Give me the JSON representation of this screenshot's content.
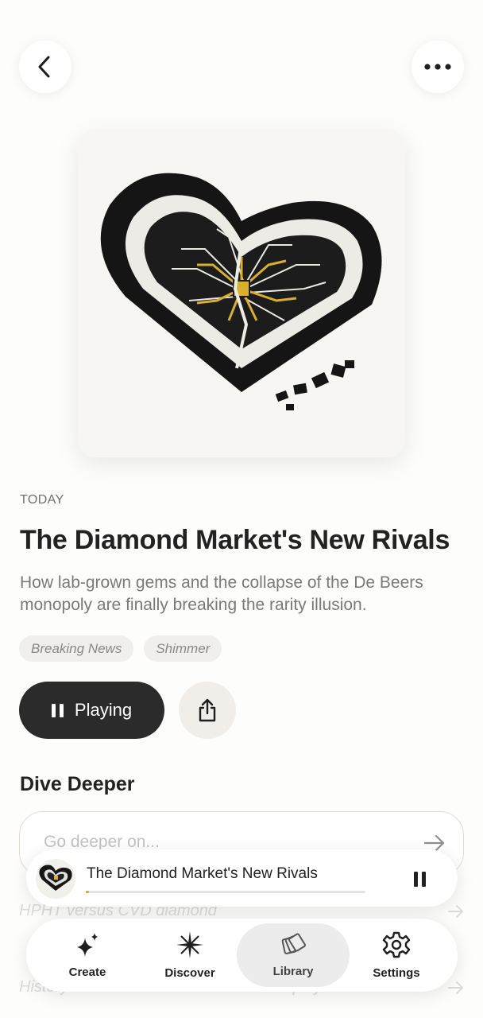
{
  "header": {
    "back_icon": "chevron-left-icon",
    "more_icon": "more-horizontal-icon"
  },
  "episode": {
    "date_label": "TODAY",
    "title": "The Diamond Market's New Rivals",
    "subtitle": "How lab-grown gems and the collapse of the De Beers monopoly are finally breaking the rarity illusion.",
    "cover_icon": "diamond-heart-circuit-artwork",
    "tags": [
      "Breaking News",
      "Shimmer"
    ],
    "play_label": "Playing",
    "share_icon": "share-icon"
  },
  "dive_deeper": {
    "title": "Dive Deeper",
    "placeholder": "Go deeper on...",
    "suggestions": [
      "HPHT versus CVD diamond",
      "History of the De Beers diamond monopoly"
    ]
  },
  "mini_player": {
    "title": "The Diamond Market's New Rivals",
    "progress": 0.01,
    "accent": "#d3a83f"
  },
  "tabs": [
    {
      "label": "Create",
      "icon": "sparkles-icon"
    },
    {
      "label": "Discover",
      "icon": "star-burst-icon"
    },
    {
      "label": "Library",
      "icon": "library-stack-icon",
      "active": true
    },
    {
      "label": "Settings",
      "icon": "gear-icon"
    }
  ]
}
